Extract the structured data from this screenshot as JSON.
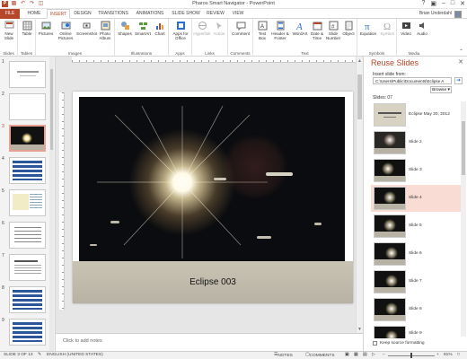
{
  "title_bar": {
    "title": "Pharos Smart Navigator - PowerPoint"
  },
  "tabs": [
    {
      "label": "FILE"
    },
    {
      "label": "HOME"
    },
    {
      "label": "INSERT"
    },
    {
      "label": "DESIGN"
    },
    {
      "label": "TRANSITIONS"
    },
    {
      "label": "ANIMATIONS"
    },
    {
      "label": "SLIDE SHOW"
    },
    {
      "label": "REVIEW"
    },
    {
      "label": "VIEW"
    }
  ],
  "active_tab": "INSERT",
  "user": {
    "name": "Brian Underdahl"
  },
  "ribbon": {
    "groups": [
      {
        "label": "Slides",
        "buttons": [
          "New Slide"
        ]
      },
      {
        "label": "Tables",
        "buttons": [
          "Table"
        ]
      },
      {
        "label": "Images",
        "buttons": [
          "Pictures",
          "Online Pictures",
          "Screenshot",
          "Photo Album"
        ]
      },
      {
        "label": "Illustrations",
        "buttons": [
          "Shapes",
          "SmartArt",
          "Chart"
        ]
      },
      {
        "label": "Apps",
        "buttons": [
          "Apps for Office"
        ]
      },
      {
        "label": "Links",
        "buttons": [
          "Hyperlink",
          "Action"
        ]
      },
      {
        "label": "Comments",
        "buttons": [
          "Comment"
        ]
      },
      {
        "label": "Text",
        "buttons": [
          "Text Box",
          "Header & Footer",
          "WordArt",
          "Date & Time",
          "Slide Number",
          "Object"
        ]
      },
      {
        "label": "Symbols",
        "buttons": [
          "Equation",
          "Symbol"
        ]
      },
      {
        "label": "Media",
        "buttons": [
          "Video",
          "Audio"
        ]
      }
    ]
  },
  "thumbnails": [
    {
      "num": "1"
    },
    {
      "num": "2"
    },
    {
      "num": "3"
    },
    {
      "num": "4"
    },
    {
      "num": "5"
    },
    {
      "num": "6"
    },
    {
      "num": "7"
    },
    {
      "num": "8"
    },
    {
      "num": "9"
    }
  ],
  "selected_thumbnail": "3",
  "slide": {
    "title": "Eclipse 003"
  },
  "notes": {
    "placeholder": "Click to add notes"
  },
  "reuse_pane": {
    "title": "Reuse Slides",
    "insert_label": "Insert slide from:",
    "path": "C:\\Users\\Public\\Documents\\Eclipse A",
    "browse_label": "Browse",
    "slides_count": "Slides: 07",
    "items": [
      {
        "label": "Eclipse May 20, 2012"
      },
      {
        "label": "Slide 2"
      },
      {
        "label": "Slide 3"
      },
      {
        "label": "Slide 4"
      },
      {
        "label": "Slide 5"
      },
      {
        "label": "Slide 6"
      },
      {
        "label": "Slide 7"
      },
      {
        "label": "Slide 8"
      },
      {
        "label": "Slide 9"
      }
    ],
    "highlighted_item": "Slide 4",
    "keep_formatting": "Keep source formatting"
  },
  "status_bar": {
    "slide_info": "SLIDE 3 OF 13",
    "language": "ENGLISH (UNITED STATES)",
    "notes_label": "NOTES",
    "comments_label": "COMMENTS",
    "zoom": "81%"
  },
  "colors": {
    "accent": "#b7472a",
    "highlight": "#f9dcd4"
  }
}
